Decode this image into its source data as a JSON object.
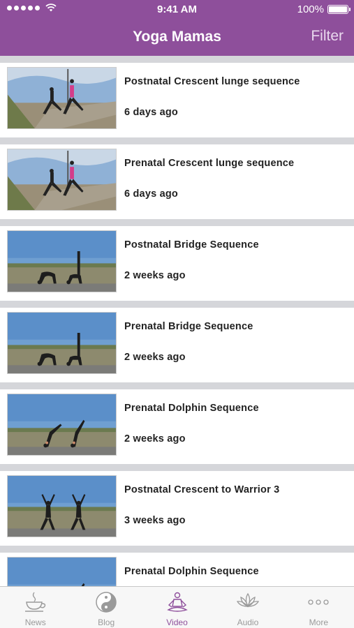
{
  "status_bar": {
    "time": "9:41 AM",
    "battery": "100%"
  },
  "nav": {
    "title": "Yoga Mamas",
    "filter_label": "Filter"
  },
  "videos": [
    {
      "title": "Postnatal Crescent lunge sequence",
      "time": "6 days ago",
      "scene": "lunge"
    },
    {
      "title": "Prenatal Crescent lunge sequence",
      "time": "6 days ago",
      "scene": "lunge"
    },
    {
      "title": "Postnatal Bridge Sequence",
      "time": "2 weeks ago",
      "scene": "bridge"
    },
    {
      "title": "Prenatal Bridge Sequence",
      "time": "2 weeks ago",
      "scene": "bridge"
    },
    {
      "title": "Prenatal Dolphin Sequence",
      "time": "2 weeks ago",
      "scene": "dolphin"
    },
    {
      "title": "Postnatal Crescent to Warrior 3",
      "time": "3 weeks ago",
      "scene": "warrior"
    },
    {
      "title": "Prenatal Dolphin Sequence",
      "time": "",
      "scene": "dolphin"
    }
  ],
  "tabs": [
    {
      "label": "News",
      "icon": "teacup-icon",
      "active": false
    },
    {
      "label": "Blog",
      "icon": "yin-yang-icon",
      "active": false
    },
    {
      "label": "Video",
      "icon": "meditating-figure-icon",
      "active": true
    },
    {
      "label": "Audio",
      "icon": "lotus-icon",
      "active": false
    },
    {
      "label": "More",
      "icon": "ellipsis-icon",
      "active": false
    }
  ],
  "colors": {
    "brand": "#8e4f9b",
    "separator": "#d5d6da",
    "inactive_tab": "#9a9a9a"
  }
}
